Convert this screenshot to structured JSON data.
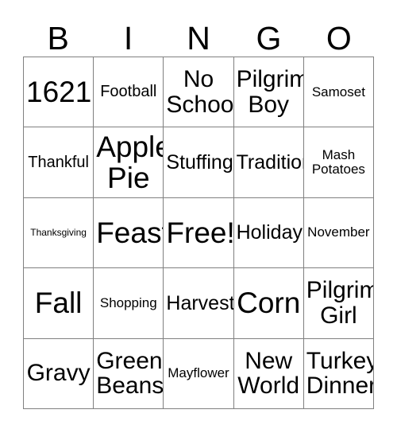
{
  "header": {
    "letters": [
      "B",
      "I",
      "N",
      "G",
      "O"
    ]
  },
  "style": {
    "background_color": "#ffffff",
    "border_color": "#808080",
    "text_color": "#000000"
  },
  "grid": {
    "columns": 5,
    "rows": 5,
    "cells": [
      {
        "text": "1621",
        "size": "fs-xl"
      },
      {
        "text": "Football",
        "size": "fs-sm"
      },
      {
        "text": "No\nSchool",
        "size": "fs-lg"
      },
      {
        "text": "Pilgrim\nBoy",
        "size": "fs-lg"
      },
      {
        "text": "Samoset",
        "size": "fs-xs"
      },
      {
        "text": "Thankful",
        "size": "fs-sm"
      },
      {
        "text": "Apple\nPie",
        "size": "fs-xl"
      },
      {
        "text": "Stuffing",
        "size": "fs-md"
      },
      {
        "text": "Tradition",
        "size": "fs-md"
      },
      {
        "text": "Mash\nPotatoes",
        "size": "fs-xs"
      },
      {
        "text": "Thanksgiving",
        "size": "fs-xxs"
      },
      {
        "text": "Feast",
        "size": "fs-xl"
      },
      {
        "text": "Free!",
        "size": "fs-xl"
      },
      {
        "text": "Holiday",
        "size": "fs-md"
      },
      {
        "text": "November",
        "size": "fs-xs"
      },
      {
        "text": "Fall",
        "size": "fs-xl"
      },
      {
        "text": "Shopping",
        "size": "fs-xs"
      },
      {
        "text": "Harvest",
        "size": "fs-md"
      },
      {
        "text": "Corn",
        "size": "fs-xl"
      },
      {
        "text": "Pilgrim\nGirl",
        "size": "fs-lg"
      },
      {
        "text": "Gravy",
        "size": "fs-lg"
      },
      {
        "text": "Green\nBeans",
        "size": "fs-lg"
      },
      {
        "text": "Mayflower",
        "size": "fs-xs"
      },
      {
        "text": "New\nWorld",
        "size": "fs-lg"
      },
      {
        "text": "Turkey\nDinner",
        "size": "fs-lg"
      }
    ]
  }
}
